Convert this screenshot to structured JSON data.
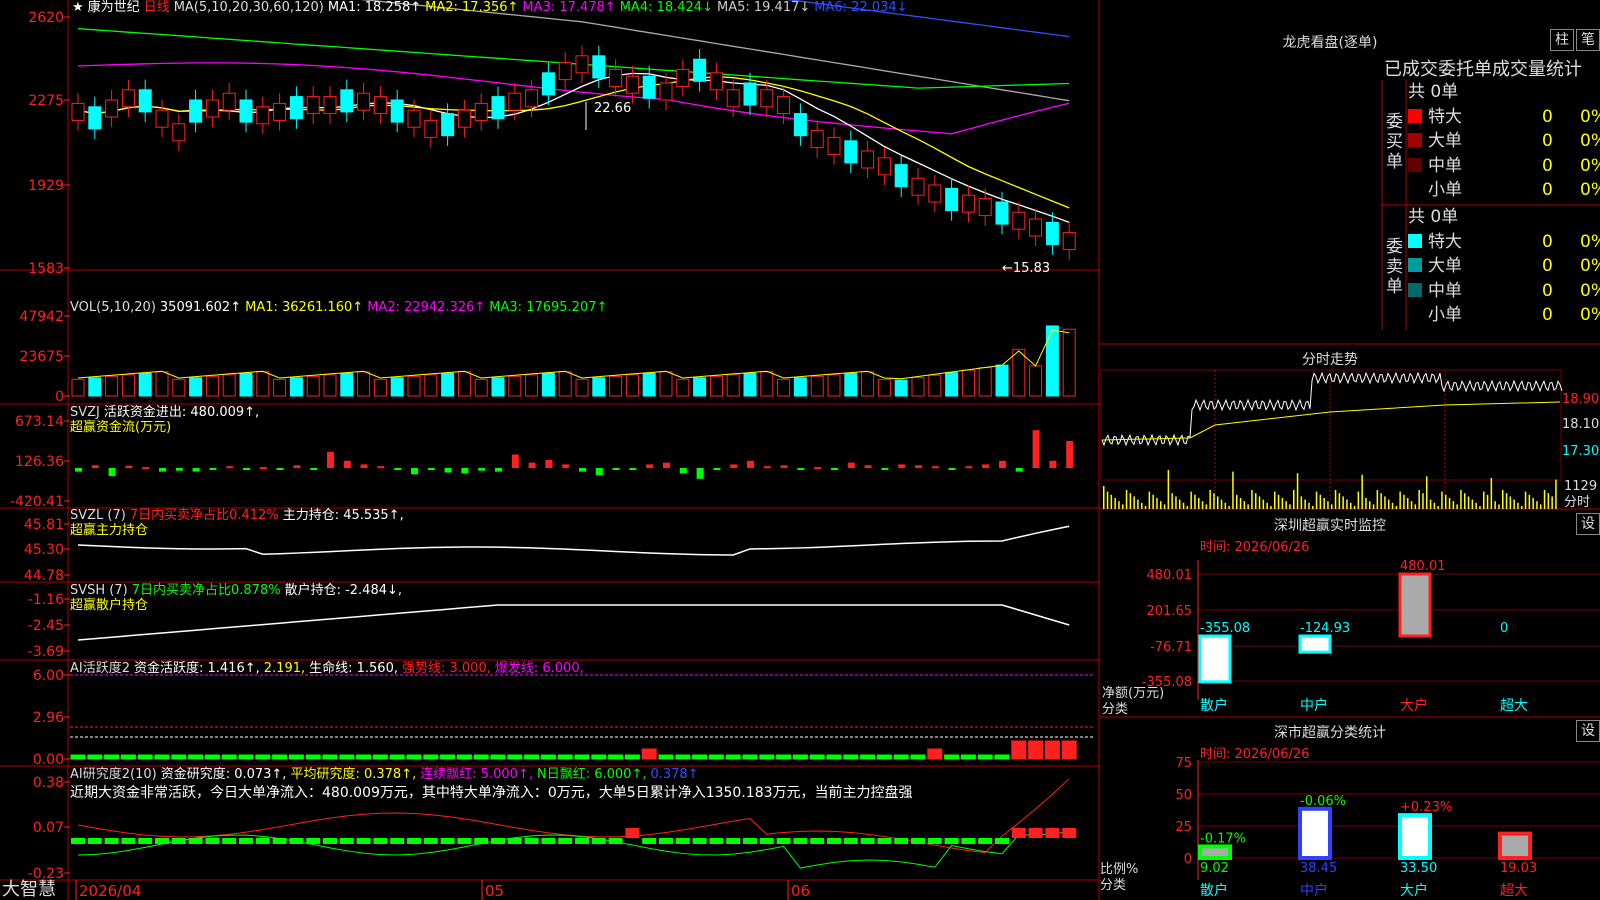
{
  "stock": {
    "name": "康为世纪",
    "period": "日线",
    "star": "★"
  },
  "main": {
    "ma_header": {
      "label": "MA(5,10,20,30,60,120)",
      "ma1": "MA1: 18.258↑",
      "ma2": "MA2: 17.356↑",
      "ma3": "MA3: 17.478↑",
      "ma4": "MA4: 18.424↓",
      "ma5": "MA5: 19.417↓",
      "ma6": "MA6: 22.034↓"
    },
    "y_ticks": [
      "2620",
      "2275",
      "1929",
      "1583"
    ],
    "high_label": "22.66",
    "low_label": "←15.83"
  },
  "vol": {
    "header": {
      "label": "VOL(5,10,20)",
      "value": "35091.602↑",
      "ma1": "MA1: 36261.160↑",
      "ma2": "MA2: 22942.326↑",
      "ma3": "MA3: 17695.207↑"
    },
    "y_ticks": [
      "47942",
      "23675",
      "0"
    ]
  },
  "svzj": {
    "header": {
      "label": "SVZJ",
      "text": "活跃资金进出: 480.009↑,"
    },
    "sub": "超赢资金流(万元)",
    "y_ticks": [
      "673.14",
      "126.36",
      "-420.41"
    ]
  },
  "svzl": {
    "header": {
      "label": "SVZL (7)",
      "ratio": "7日内买卖净占比0.412%",
      "main": "主力持仓: 45.535↑,"
    },
    "sub": "超赢主力持仓",
    "y_ticks": [
      "45.81",
      "45.30",
      "44.78"
    ]
  },
  "svsh": {
    "header": {
      "label": "SVSH (7)",
      "ratio": "7日内买卖净占比0.878%",
      "retail": "散户持仓: -2.484↓,"
    },
    "sub": "超赢散户持仓",
    "y_ticks": [
      "-1.16",
      "-2.45",
      "-3.69"
    ]
  },
  "ai1": {
    "header": {
      "label": "AI活跃度2",
      "a": "资金活跃度: 1.416↑,",
      "b": "2.191,",
      "c": "生命线: 1.560,",
      "d": "强势线: 3.000,",
      "e": "爆发线: 6.000,"
    },
    "y_ticks": [
      "6.00",
      "2.96",
      "0.00"
    ]
  },
  "ai2": {
    "header": {
      "label": "AI研究度2(10)",
      "a": "资金研究度: 0.073↑,",
      "b": "平均研究度: 0.378↑,",
      "c": "连续飘红: 5.000↑,",
      "d": "N日飘红: 6.000↑,",
      "e": "0.378↑"
    },
    "desc": "近期大资金非常活跃，今日大单净流入：480.009万元，其中特大单净流入：0万元，大单5日累计净入1350.183万元，当前主力控盘强",
    "y_ticks": [
      "0.38",
      "0.07",
      "-0.23"
    ]
  },
  "bottom": {
    "brand": "大智慧",
    "dates": [
      "2026/04",
      "05",
      "06"
    ]
  },
  "right": {
    "lhb_title": "龙虎看盘(逐单)",
    "btn1": "柱",
    "btn2": "笔",
    "stat_title": "已成交委托单成交量统计",
    "buy": {
      "label": "委买单",
      "total": "共 0单",
      "rows": [
        {
          "name": "特大",
          "num": "0",
          "pct": "0%",
          "color": "#ff0000"
        },
        {
          "name": "大单",
          "num": "0",
          "pct": "0%",
          "color": "#a00000"
        },
        {
          "name": "中单",
          "num": "0",
          "pct": "0%",
          "color": "#600000"
        },
        {
          "name": "小单",
          "num": "0",
          "pct": "0%",
          "color": "#000000"
        }
      ]
    },
    "sell": {
      "label": "委卖单",
      "total": "共 0单",
      "rows": [
        {
          "name": "特大",
          "num": "0",
          "pct": "0%",
          "color": "#00ffff"
        },
        {
          "name": "大单",
          "num": "0",
          "pct": "0%",
          "color": "#009c9c"
        },
        {
          "name": "中单",
          "num": "0",
          "pct": "0%",
          "color": "#006a6a"
        },
        {
          "name": "小单",
          "num": "0",
          "pct": "0%",
          "color": "#000000"
        }
      ]
    },
    "fs_title": "分时走势",
    "fs_ticks": [
      "18.90",
      "18.10",
      "17.30"
    ],
    "fs_vol_tick": "1129",
    "fs_vol_label": "分时",
    "sz_title": "深圳超赢实时监控",
    "set1": "设",
    "sz_time": "时间: 2026/06/26",
    "sz_ticks": [
      "480.01",
      "201.65",
      "-76.71",
      "-355.08"
    ],
    "sz_unit": "净额(万元)",
    "sz_cat": "分类",
    "sz_values": {
      "retail": "-355.08",
      "mid": "-124.93",
      "big": "480.01",
      "super": "0"
    },
    "cat_labels": [
      "散户",
      "中户",
      "大户",
      "超大"
    ],
    "sc_title": "深市超赢分类统计",
    "set2": "设",
    "sc_time": "时间: 2026/06/26",
    "sc_ticks": [
      "75",
      "50",
      "25",
      "0"
    ],
    "sc_unit": "比例%",
    "sc_cat": "分类",
    "sc_values": [
      "9.02",
      "38.45",
      "33.50",
      "19.03"
    ],
    "sc_changes": [
      "-0.17%",
      "-0.06%",
      "+0.23%"
    ]
  }
}
